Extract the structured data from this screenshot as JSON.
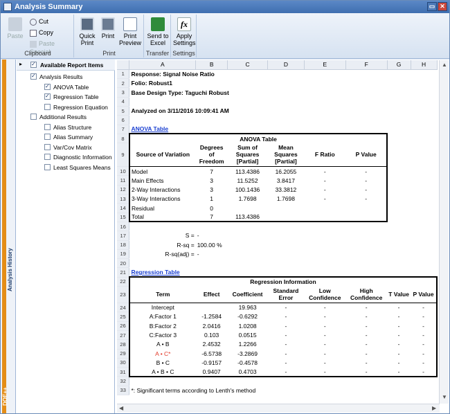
{
  "window": {
    "title": "Analysis Summary"
  },
  "ribbon": {
    "groups": [
      {
        "label": "Clipboard"
      },
      {
        "label": "Print"
      },
      {
        "label": "Transfer"
      },
      {
        "label": "Settings"
      }
    ],
    "paste": "Paste",
    "cut": "Cut",
    "copy": "Copy",
    "paste_special": "Paste Special",
    "quick_print": [
      "Quick",
      "Print"
    ],
    "print": "Print",
    "print_preview": [
      "Print",
      "Preview"
    ],
    "send_excel": [
      "Send to",
      "Excel"
    ],
    "apply_settings": [
      "Apply",
      "Settings"
    ]
  },
  "sidebar": {
    "vertical_label": "Analysis History",
    "logo": "DOE++"
  },
  "tree": {
    "header": "Available Report Items",
    "items": [
      {
        "label": "Analysis Results",
        "checked": true,
        "level": 0
      },
      {
        "label": "ANOVA Table",
        "checked": true,
        "level": 1
      },
      {
        "label": "Regression Table",
        "checked": true,
        "level": 1
      },
      {
        "label": "Regression Equation",
        "checked": false,
        "level": 1
      },
      {
        "label": "Additional Results",
        "checked": false,
        "level": 0
      },
      {
        "label": "Alias Structure",
        "checked": false,
        "level": 1
      },
      {
        "label": "Alias Summary",
        "checked": false,
        "level": 1
      },
      {
        "label": "Var/Cov Matrix",
        "checked": false,
        "level": 1
      },
      {
        "label": "Diagnostic Information",
        "checked": false,
        "level": 1
      },
      {
        "label": "Least Squares Means",
        "checked": false,
        "level": 1
      }
    ]
  },
  "sheet": {
    "columns": [
      "A",
      "B",
      "C",
      "D",
      "E",
      "F",
      "G",
      "H"
    ],
    "rows": [
      {
        "n": "1",
        "cells": [
          {
            "t": "Response: Signal Noise Ratio",
            "cls": "b",
            "span": 4
          }
        ]
      },
      {
        "n": "2",
        "cells": [
          {
            "t": "Folio: Robust1",
            "cls": "b",
            "span": 4
          }
        ]
      },
      {
        "n": "3",
        "cells": [
          {
            "t": "Base Design Type: Taguchi Robust",
            "cls": "b",
            "span": 4
          }
        ]
      },
      {
        "n": "4",
        "cells": []
      },
      {
        "n": "5",
        "cells": [
          {
            "t": "Analyzed on 3/11/2016 10:09:41 AM",
            "cls": "b",
            "span": 4
          }
        ]
      },
      {
        "n": "6",
        "cells": []
      },
      {
        "n": "7",
        "cells": [
          {
            "t": "ANOVA Table",
            "cls": "link",
            "span": 2
          }
        ]
      },
      {
        "n": "8",
        "cells": [
          {
            "t": "ANOVA Table",
            "cls": "b c",
            "span": 6,
            "box": "top"
          }
        ]
      },
      {
        "n": "9",
        "cells": [
          {
            "t": "Source of Variation",
            "cls": "b c"
          },
          {
            "t": "Degrees of Freedom",
            "cls": "b c"
          },
          {
            "t": "Sum of Squares [Partial]",
            "cls": "b c"
          },
          {
            "t": "Mean Squares [Partial]",
            "cls": "b c"
          },
          {
            "t": "F Ratio",
            "cls": "b c"
          },
          {
            "t": "P Value",
            "cls": "b c"
          }
        ],
        "tall": true
      },
      {
        "n": "10",
        "cells": [
          {
            "t": "Model"
          },
          {
            "t": "7",
            "cls": "c"
          },
          {
            "t": "113.4386",
            "cls": "c"
          },
          {
            "t": "16.2055",
            "cls": "c"
          },
          {
            "t": "-",
            "cls": "c"
          },
          {
            "t": "-",
            "cls": "c"
          }
        ]
      },
      {
        "n": "11",
        "cells": [
          {
            "t": "  Main Effects"
          },
          {
            "t": "3",
            "cls": "c"
          },
          {
            "t": "11.5252",
            "cls": "c"
          },
          {
            "t": "3.8417",
            "cls": "c"
          },
          {
            "t": "-",
            "cls": "c"
          },
          {
            "t": "-",
            "cls": "c"
          }
        ]
      },
      {
        "n": "12",
        "cells": [
          {
            "t": "  2-Way Interactions"
          },
          {
            "t": "3",
            "cls": "c"
          },
          {
            "t": "100.1436",
            "cls": "c"
          },
          {
            "t": "33.3812",
            "cls": "c"
          },
          {
            "t": "-",
            "cls": "c"
          },
          {
            "t": "-",
            "cls": "c"
          }
        ]
      },
      {
        "n": "13",
        "cells": [
          {
            "t": "  3-Way Interactions"
          },
          {
            "t": "1",
            "cls": "c"
          },
          {
            "t": "1.7698",
            "cls": "c"
          },
          {
            "t": "1.7698",
            "cls": "c"
          },
          {
            "t": "-",
            "cls": "c"
          },
          {
            "t": "-",
            "cls": "c"
          }
        ]
      },
      {
        "n": "14",
        "cells": [
          {
            "t": "Residual"
          },
          {
            "t": "0",
            "cls": "c"
          },
          {
            "t": ""
          },
          {
            "t": ""
          },
          {
            "t": ""
          },
          {
            "t": ""
          }
        ]
      },
      {
        "n": "15",
        "cells": [
          {
            "t": "Total"
          },
          {
            "t": "7",
            "cls": "c"
          },
          {
            "t": "113.4386",
            "cls": "c"
          },
          {
            "t": ""
          },
          {
            "t": ""
          },
          {
            "t": ""
          }
        ],
        "box": "bottom"
      },
      {
        "n": "16",
        "cells": []
      },
      {
        "n": "17",
        "cells": [
          {
            "t": "S =",
            "cls": "r"
          },
          {
            "t": "-"
          }
        ]
      },
      {
        "n": "18",
        "cells": [
          {
            "t": "R-sq =",
            "cls": "r"
          },
          {
            "t": "100.00 %"
          }
        ]
      },
      {
        "n": "19",
        "cells": [
          {
            "t": "R-sq(adj) =",
            "cls": "r"
          },
          {
            "t": "-"
          }
        ]
      },
      {
        "n": "20",
        "cells": []
      },
      {
        "n": "21",
        "cells": [
          {
            "t": "Regression Table",
            "cls": "link",
            "span": 2
          }
        ]
      },
      {
        "n": "22",
        "cells": [
          {
            "t": "Regression Information",
            "cls": "b c",
            "span": 8,
            "box": "top"
          }
        ]
      },
      {
        "n": "23",
        "cells": [
          {
            "t": "Term",
            "cls": "b c"
          },
          {
            "t": "Effect",
            "cls": "b c"
          },
          {
            "t": "Coefficient",
            "cls": "b c"
          },
          {
            "t": "Standard Error",
            "cls": "b c"
          },
          {
            "t": "Low Confidence",
            "cls": "b c"
          },
          {
            "t": "High Confidence",
            "cls": "b c"
          },
          {
            "t": "T Value",
            "cls": "b c"
          },
          {
            "t": "P Value",
            "cls": "b c"
          }
        ],
        "tall": true
      },
      {
        "n": "24",
        "cells": [
          {
            "t": "Intercept",
            "cls": "c"
          },
          {
            "t": ""
          },
          {
            "t": "19.963",
            "cls": "c"
          },
          {
            "t": "-",
            "cls": "c"
          },
          {
            "t": "-",
            "cls": "c"
          },
          {
            "t": "-",
            "cls": "c"
          },
          {
            "t": "-",
            "cls": "c"
          },
          {
            "t": "-",
            "cls": "c"
          }
        ]
      },
      {
        "n": "25",
        "cells": [
          {
            "t": "A:Factor 1",
            "cls": "c"
          },
          {
            "t": "-1.2584",
            "cls": "c"
          },
          {
            "t": "-0.6292",
            "cls": "c"
          },
          {
            "t": "-",
            "cls": "c"
          },
          {
            "t": "-",
            "cls": "c"
          },
          {
            "t": "-",
            "cls": "c"
          },
          {
            "t": "-",
            "cls": "c"
          },
          {
            "t": "-",
            "cls": "c"
          }
        ]
      },
      {
        "n": "26",
        "cells": [
          {
            "t": "B:Factor 2",
            "cls": "c"
          },
          {
            "t": "2.0416",
            "cls": "c"
          },
          {
            "t": "1.0208",
            "cls": "c"
          },
          {
            "t": "-",
            "cls": "c"
          },
          {
            "t": "-",
            "cls": "c"
          },
          {
            "t": "-",
            "cls": "c"
          },
          {
            "t": "-",
            "cls": "c"
          },
          {
            "t": "-",
            "cls": "c"
          }
        ]
      },
      {
        "n": "27",
        "cells": [
          {
            "t": "C:Factor 3",
            "cls": "c"
          },
          {
            "t": "0.103",
            "cls": "c"
          },
          {
            "t": "0.0515",
            "cls": "c"
          },
          {
            "t": "-",
            "cls": "c"
          },
          {
            "t": "-",
            "cls": "c"
          },
          {
            "t": "-",
            "cls": "c"
          },
          {
            "t": "-",
            "cls": "c"
          },
          {
            "t": "-",
            "cls": "c"
          }
        ]
      },
      {
        "n": "28",
        "cells": [
          {
            "t": "A • B",
            "cls": "c"
          },
          {
            "t": "2.4532",
            "cls": "c"
          },
          {
            "t": "1.2266",
            "cls": "c"
          },
          {
            "t": "-",
            "cls": "c"
          },
          {
            "t": "-",
            "cls": "c"
          },
          {
            "t": "-",
            "cls": "c"
          },
          {
            "t": "-",
            "cls": "c"
          },
          {
            "t": "-",
            "cls": "c"
          }
        ]
      },
      {
        "n": "29",
        "cells": [
          {
            "t": "A • C*",
            "cls": "c red"
          },
          {
            "t": "-6.5738",
            "cls": "c"
          },
          {
            "t": "-3.2869",
            "cls": "c"
          },
          {
            "t": "-",
            "cls": "c"
          },
          {
            "t": "-",
            "cls": "c"
          },
          {
            "t": "-",
            "cls": "c"
          },
          {
            "t": "-",
            "cls": "c"
          },
          {
            "t": "-",
            "cls": "c"
          }
        ]
      },
      {
        "n": "30",
        "cells": [
          {
            "t": "B • C",
            "cls": "c"
          },
          {
            "t": "-0.9157",
            "cls": "c"
          },
          {
            "t": "-0.4578",
            "cls": "c"
          },
          {
            "t": "-",
            "cls": "c"
          },
          {
            "t": "-",
            "cls": "c"
          },
          {
            "t": "-",
            "cls": "c"
          },
          {
            "t": "-",
            "cls": "c"
          },
          {
            "t": "-",
            "cls": "c"
          }
        ]
      },
      {
        "n": "31",
        "cells": [
          {
            "t": "A • B • C",
            "cls": "c"
          },
          {
            "t": "0.9407",
            "cls": "c"
          },
          {
            "t": "0.4703",
            "cls": "c"
          },
          {
            "t": "-",
            "cls": "c"
          },
          {
            "t": "-",
            "cls": "c"
          },
          {
            "t": "-",
            "cls": "c"
          },
          {
            "t": "-",
            "cls": "c"
          },
          {
            "t": "-",
            "cls": "c"
          }
        ],
        "box": "bottom"
      },
      {
        "n": "32",
        "cells": []
      },
      {
        "n": "33",
        "cells": [
          {
            "t": "*: Significant terms according to Lenth's method",
            "span": 4
          }
        ]
      }
    ]
  }
}
